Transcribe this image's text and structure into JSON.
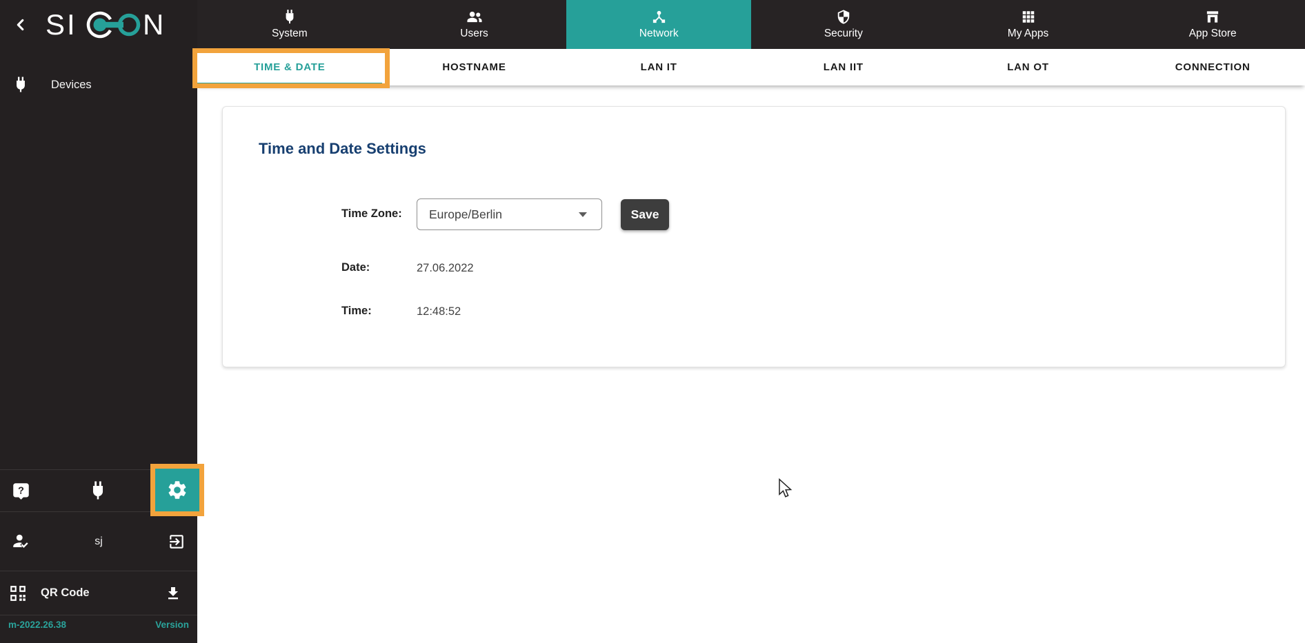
{
  "brand": {
    "name": "SICON",
    "logo_left": "SI",
    "logo_right": "N"
  },
  "sidebar": {
    "devices_label": "Devices",
    "username": "sj",
    "qr_label": "QR Code",
    "version_value": "m-2022.26.38",
    "version_label": "Version"
  },
  "topnav": {
    "items": [
      {
        "label": "System",
        "active": false
      },
      {
        "label": "Users",
        "active": false
      },
      {
        "label": "Network",
        "active": true
      },
      {
        "label": "Security",
        "active": false
      },
      {
        "label": "My Apps",
        "active": false
      },
      {
        "label": "App Store",
        "active": false
      }
    ]
  },
  "tabs": {
    "items": [
      "TIME & DATE",
      "HOSTNAME",
      "LAN IT",
      "LAN IIT",
      "LAN OT",
      "CONNECTION"
    ],
    "active": "TIME & DATE"
  },
  "content": {
    "heading": "Time and Date Settings",
    "timezone": {
      "label": "Time Zone:",
      "value": "Europe/Berlin"
    },
    "save_label": "Save",
    "date": {
      "label": "Date:",
      "value": "27.06.2022"
    },
    "time": {
      "label": "Time:",
      "value": "12:48:52"
    }
  },
  "colors": {
    "accent_teal": "#26a099",
    "annotation_orange": "#f2a33c",
    "heading_navy": "#173f70",
    "dark_bg": "#262223"
  }
}
